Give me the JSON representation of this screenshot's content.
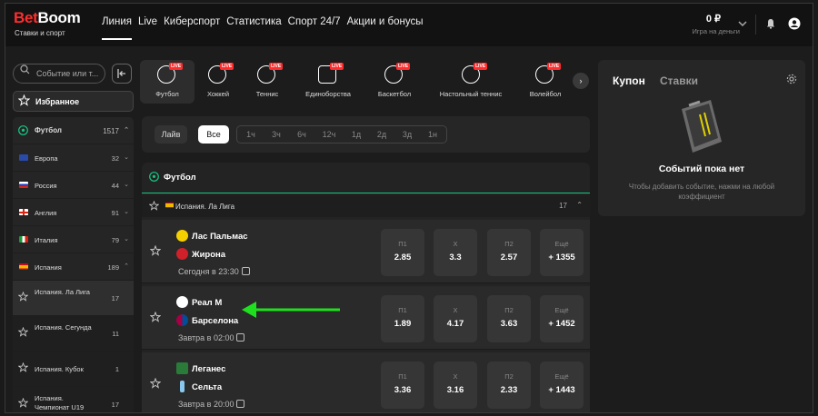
{
  "header": {
    "logo_main": "Bet",
    "logo_accent": "Boom",
    "logo_sub": "Ставки и спорт",
    "nav": [
      "Линия",
      "Live",
      "Киберспорт",
      "Статистика",
      "Спорт 24/7",
      "Акции и бонусы"
    ],
    "balance": "0 ₽",
    "balance_sub": "Игра на деньги"
  },
  "sidebar": {
    "search_placeholder": "Событие или т...",
    "favorites": "Избранное",
    "sport": {
      "label": "Футбол",
      "count": "1517"
    },
    "countries": [
      {
        "label": "Европа",
        "count": "32"
      },
      {
        "label": "Россия",
        "count": "44"
      },
      {
        "label": "Англия",
        "count": "91"
      },
      {
        "label": "Италия",
        "count": "79"
      },
      {
        "label": "Испания",
        "count": "189"
      }
    ],
    "leagues": [
      {
        "label": "Испания. Ла Лига",
        "count": "17"
      },
      {
        "label": "Испания. Сегунда",
        "count": "11"
      },
      {
        "label": "Испания. Кубок",
        "count": "1"
      },
      {
        "label": "Испания. Чемпионат U19",
        "count": "17"
      }
    ]
  },
  "sports_tabs": [
    {
      "label": "Футбол",
      "live": "LIVE"
    },
    {
      "label": "Хоккей",
      "live": "LIVE"
    },
    {
      "label": "Теннис",
      "live": "LIVE"
    },
    {
      "label": "Единоборства",
      "live": "LIVE"
    },
    {
      "label": "Баскетбол",
      "live": "LIVE"
    },
    {
      "label": "Настольный теннис",
      "live": "LIVE"
    },
    {
      "label": "Волейбол",
      "live": "LIVE"
    }
  ],
  "filters": {
    "live": "Лайв",
    "all": "Все",
    "times": [
      "1ч",
      "3ч",
      "6ч",
      "12ч",
      "1д",
      "2д",
      "3д",
      "1н"
    ]
  },
  "section_title": "Футбол",
  "league": {
    "label": "Испания. Ла Лига",
    "count": "17"
  },
  "matches": [
    {
      "team1": "Лас Пальмас",
      "team2": "Жирона",
      "time": "Сегодня в 23:30",
      "odds": [
        {
          "k": "П1",
          "v": "2.85"
        },
        {
          "k": "Х",
          "v": "3.3"
        },
        {
          "k": "П2",
          "v": "2.57"
        },
        {
          "k": "Ещё",
          "v": "+ 1355"
        }
      ]
    },
    {
      "team1": "Реал М",
      "team2": "Барселона",
      "time": "Завтра в 02:00",
      "odds": [
        {
          "k": "П1",
          "v": "1.89"
        },
        {
          "k": "Х",
          "v": "4.17"
        },
        {
          "k": "П2",
          "v": "3.63"
        },
        {
          "k": "Ещё",
          "v": "+ 1452"
        }
      ]
    },
    {
      "team1": "Леганес",
      "team2": "Сельта",
      "time": "Завтра в 20:00",
      "odds": [
        {
          "k": "П1",
          "v": "3.36"
        },
        {
          "k": "Х",
          "v": "3.16"
        },
        {
          "k": "П2",
          "v": "2.33"
        },
        {
          "k": "Ещё",
          "v": "+ 1443"
        }
      ]
    }
  ],
  "coupon": {
    "tab1": "Купон",
    "tab2": "Ставки",
    "empty_title": "Событий пока нет",
    "empty_hint": "Чтобы добавить событие, нажми на любой коэффициент"
  },
  "colors": {
    "brand_red": "#ff2d2d",
    "accent_green": "#16c784",
    "arrow_green": "#1ee01e"
  }
}
